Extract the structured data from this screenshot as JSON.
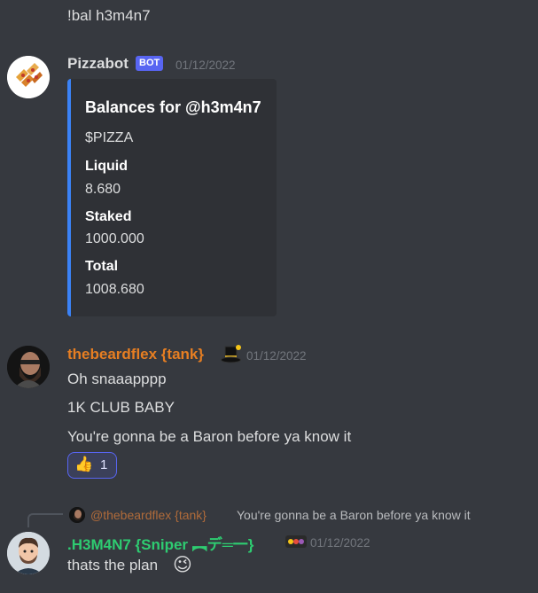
{
  "top_message": {
    "text": "!bal h3m4n7"
  },
  "pizzabot": {
    "username": "Pizzabot",
    "bot_tag": "BOT",
    "timestamp": "01/12/2022",
    "username_color": "#dcddde",
    "embed": {
      "title": "Balances for @h3m4n7",
      "description": "$PIZZA",
      "accent_color": "#3b82f6",
      "fields": [
        {
          "name": "Liquid",
          "value": "8.680"
        },
        {
          "name": "Staked",
          "value": "1000.000"
        },
        {
          "name": "Total",
          "value": "1008.680"
        }
      ]
    }
  },
  "beardflex": {
    "username": "thebeardflex {tank}",
    "username_color": "#e67e22",
    "badge_icon": "top-hat-icon",
    "timestamp": "01/12/2022",
    "lines": [
      "Oh snaaapppp",
      "1K CLUB BABY",
      "You're gonna be a Baron before ya know it"
    ],
    "reaction": {
      "emoji": "👍",
      "count": "1"
    }
  },
  "h3m4n7": {
    "reply": {
      "username": "@thebeardflex {tank}",
      "text": "You're gonna be a Baron before ya know it"
    },
    "username": ".H3M4N7 {Sniper ︻デ═一}",
    "username_color": "#2ecc71",
    "badge_icon": "1000-badge-icon",
    "timestamp": "01/12/2022",
    "text": "thats the plan",
    "emoji": "😉"
  }
}
